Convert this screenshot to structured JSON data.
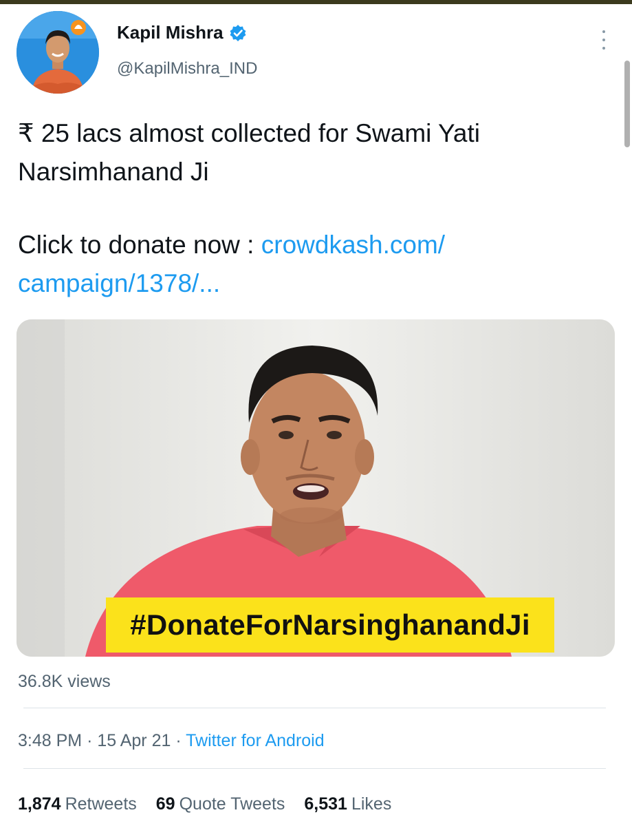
{
  "tweet": {
    "author_name": "Kapil Mishra",
    "handle": "@KapilMishra_IND",
    "text_line1": "₹ 25 lacs almost collected for Swami Yati Narsimhanand Ji",
    "text_line2_prefix": "Click to donate now : ",
    "link_text": "crowdkash.com/ campaign/1378/...",
    "media_caption": "#DonateForNarsinghanandJi",
    "views": "36.8K views",
    "time": "3:48 PM",
    "date": "15 Apr 21",
    "source": "Twitter for Android"
  },
  "stats": {
    "retweets_count": "1,874",
    "retweets_label": "Retweets",
    "quotes_count": "69",
    "quotes_label": "Quote Tweets",
    "likes_count": "6,531",
    "likes_label": "Likes"
  },
  "colors": {
    "link": "#1d9bf0",
    "caption_bg": "#fbe21b",
    "verified": "#1d9bf0"
  },
  "icons": {
    "verified": "verified-badge-icon",
    "more": "more-vertical-icon"
  }
}
